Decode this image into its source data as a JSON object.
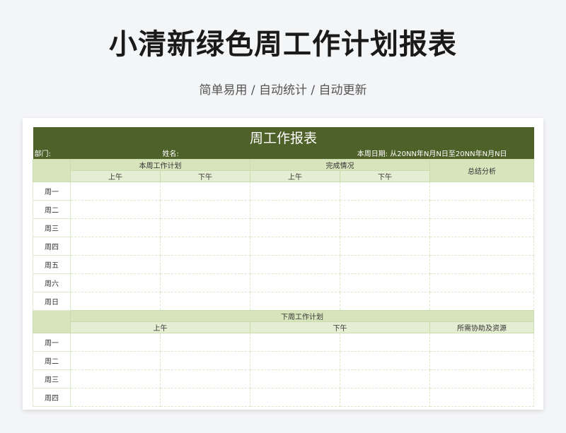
{
  "page": {
    "title": "小清新绿色周工作计划报表",
    "subtitle": "简单易用 / 自动统计 / 自动更新"
  },
  "sheet": {
    "title": "周工作报表",
    "info": {
      "dept_label": "部门:",
      "name_label": "姓名:",
      "date_label": "本周日期: 从20NN年N月N日至20NN年N月N日"
    },
    "this_week": {
      "plan_header": "本周工作计划",
      "done_header": "完成情况",
      "summary_header": "总结分析",
      "am": "上午",
      "pm": "下午",
      "days": [
        "周一",
        "周二",
        "周三",
        "周四",
        "周五",
        "周六",
        "周日"
      ]
    },
    "next_week": {
      "plan_header": "下周工作计划",
      "am": "上午",
      "pm": "下午",
      "help_header": "所需协助及资源",
      "days": [
        "周一",
        "周二",
        "周三",
        "周四"
      ]
    }
  }
}
